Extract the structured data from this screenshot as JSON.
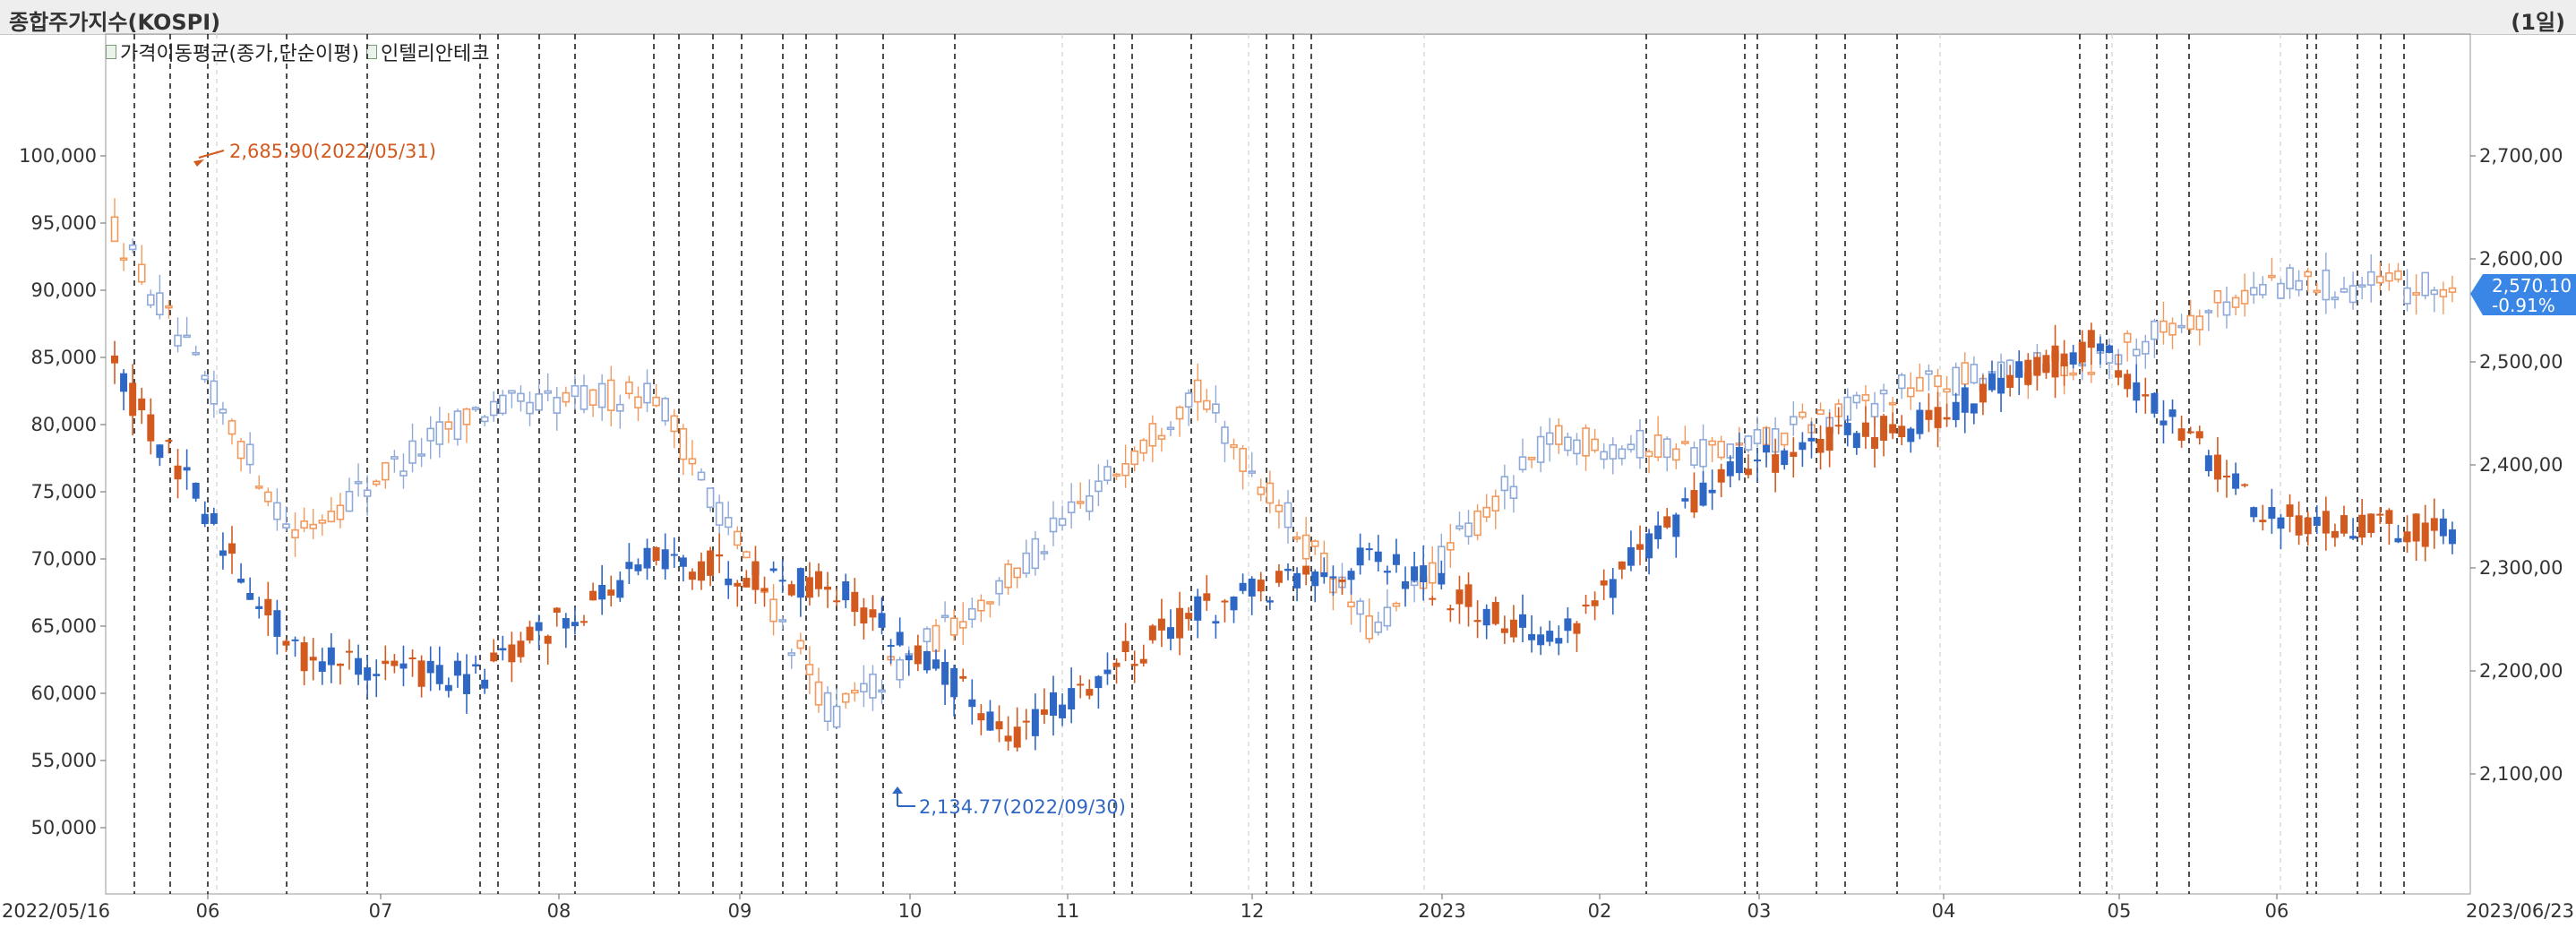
{
  "header": {
    "title": "종합주가지수(KOSPI)",
    "period": "(1일)"
  },
  "legend": {
    "items": [
      {
        "label": "가격이동평균(종가,단순이평)"
      },
      {
        "label": "인텔리안테크"
      }
    ]
  },
  "chart_data": {
    "type": "candlestick",
    "left_axis": {
      "ticks": [
        "100,000",
        "95,000",
        "90,000",
        "85,000",
        "80,000",
        "75,000",
        "70,000",
        "65,000",
        "60,000",
        "55,000",
        "50,000"
      ],
      "values": [
        100000,
        95000,
        90000,
        85000,
        80000,
        75000,
        70000,
        65000,
        60000,
        55000,
        50000
      ]
    },
    "right_axis": {
      "ticks": [
        "2,700,00",
        "2,600,00",
        "2,500,00",
        "2,400,00",
        "2,300,00",
        "2,200,00",
        "2,100,00"
      ],
      "values": [
        2700,
        2600,
        2500,
        2400,
        2300,
        2200,
        2100
      ]
    },
    "x_labels": [
      "2022/05/16",
      "06",
      "07",
      "08",
      "09",
      "10",
      "11",
      "12",
      "2023",
      "02",
      "03",
      "04",
      "05",
      "06",
      "2023/06/23"
    ],
    "annotations": {
      "high_label": "2,685.90(2022/05/31)",
      "low_label": "2,134.77(2022/09/30)",
      "current_value": "2,570.10",
      "current_change": "-0.91%"
    },
    "colors": {
      "up": "#d35a1e",
      "down": "#2f67c4",
      "kospi_up": "#f29a5e",
      "kospi_down": "#8fa9d8",
      "badge": "#3a86e6"
    },
    "kospi_series": [
      {
        "month": "2022/05",
        "close": 2630
      },
      {
        "month": "2022/06",
        "close": 2332
      },
      {
        "month": "2022/07",
        "close": 2452
      },
      {
        "month": "2022/08",
        "close": 2472
      },
      {
        "month": "2022/09",
        "close": 2155
      },
      {
        "month": "2022/10",
        "close": 2293
      },
      {
        "month": "2022/11",
        "close": 2473
      },
      {
        "month": "2022/12",
        "close": 2236
      },
      {
        "month": "2023/01",
        "close": 2425
      },
      {
        "month": "2023/02",
        "close": 2412
      },
      {
        "month": "2023/03",
        "close": 2476
      },
      {
        "month": "2023/04",
        "close": 2501
      },
      {
        "month": "2023/05",
        "close": 2577
      },
      {
        "month": "2023/06",
        "close": 2570
      }
    ],
    "stock_series": [
      {
        "month": "2022/05",
        "close": 84000
      },
      {
        "month": "2022/06",
        "close": 63000
      },
      {
        "month": "2022/07",
        "close": 61000
      },
      {
        "month": "2022/08",
        "close": 70000
      },
      {
        "month": "2022/09",
        "close": 68000
      },
      {
        "month": "2022/10",
        "close": 57000
      },
      {
        "month": "2022/11",
        "close": 66000
      },
      {
        "month": "2022/12",
        "close": 70000
      },
      {
        "month": "2023/01",
        "close": 64000
      },
      {
        "month": "2023/02",
        "close": 77000
      },
      {
        "month": "2023/03",
        "close": 80000
      },
      {
        "month": "2023/04",
        "close": 86000
      },
      {
        "month": "2023/05",
        "close": 73000
      },
      {
        "month": "2023/06",
        "close": 72000
      }
    ]
  }
}
